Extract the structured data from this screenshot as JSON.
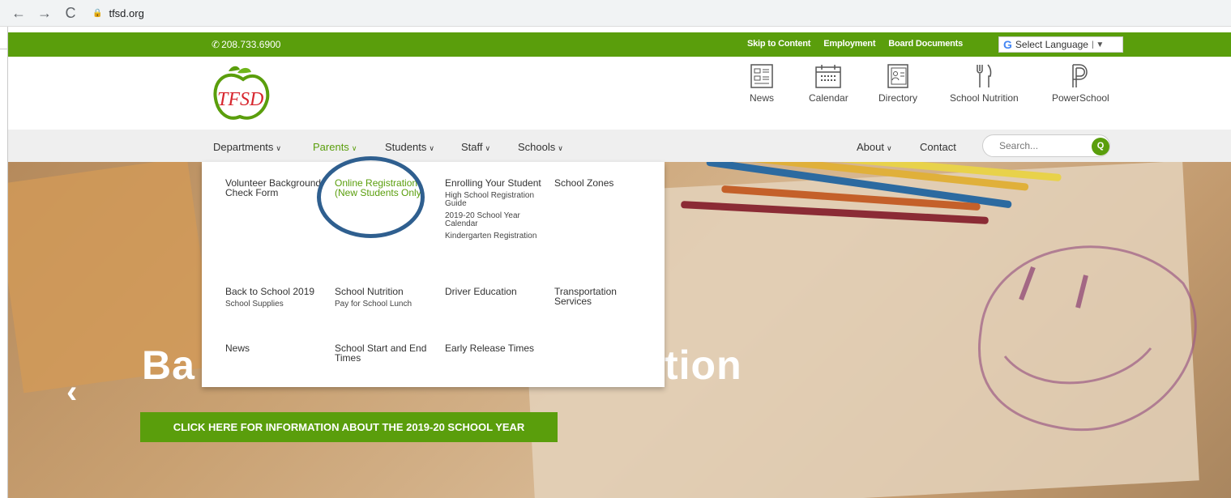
{
  "browser": {
    "back": "←",
    "forward": "→",
    "reload": "C",
    "url": "tfsd.org"
  },
  "topbar": {
    "phone": "208.733.6900",
    "links": [
      "Skip to Content",
      "Employment",
      "Board Documents"
    ],
    "language_label": "Select Language",
    "language_caret": "▼",
    "google_glyph": "G"
  },
  "header": {
    "logo_text": "TFSD",
    "quick_links": [
      "News",
      "Calendar",
      "Directory",
      "School Nutrition",
      "PowerSchool"
    ]
  },
  "nav": {
    "items": [
      "Departments",
      "Parents",
      "Students",
      "Staff",
      "Schools"
    ],
    "right_items": [
      "About",
      "Contact"
    ],
    "contact": "Contact",
    "search_placeholder": "Search...",
    "search_glyph": "Q",
    "active": "Parents"
  },
  "mega_menu": {
    "col1": {
      "r1": "Volunteer Background Check Form",
      "r2": "Back to School 2019",
      "r2_sub": "School Supplies",
      "r3": "News"
    },
    "col2": {
      "r1": "Online Registration (New Students Only)",
      "r2": "School Nutrition",
      "r2_sub": "Pay for School Lunch",
      "r3": "School Start and End Times"
    },
    "col3": {
      "r1": "Enrolling Your Student",
      "r1_subs": [
        "High School Registration Guide",
        "2019-20 School Year Calendar",
        "Kindergarten Registration"
      ],
      "r2": "Driver Education",
      "r3": "Early Release Times"
    },
    "col4": {
      "r1": "School Zones",
      "r2": "Transportation Services"
    }
  },
  "hero": {
    "title_left": "Ba",
    "title_right": "tion",
    "prev_arrow": "‹",
    "cta": "CLICK HERE FOR INFORMATION ABOUT THE 2019-20 SCHOOL YEAR"
  },
  "colors": {
    "brand_green": "#5a9e0c",
    "annotation_blue": "#2f5f8f",
    "logo_red": "#d7262e"
  }
}
